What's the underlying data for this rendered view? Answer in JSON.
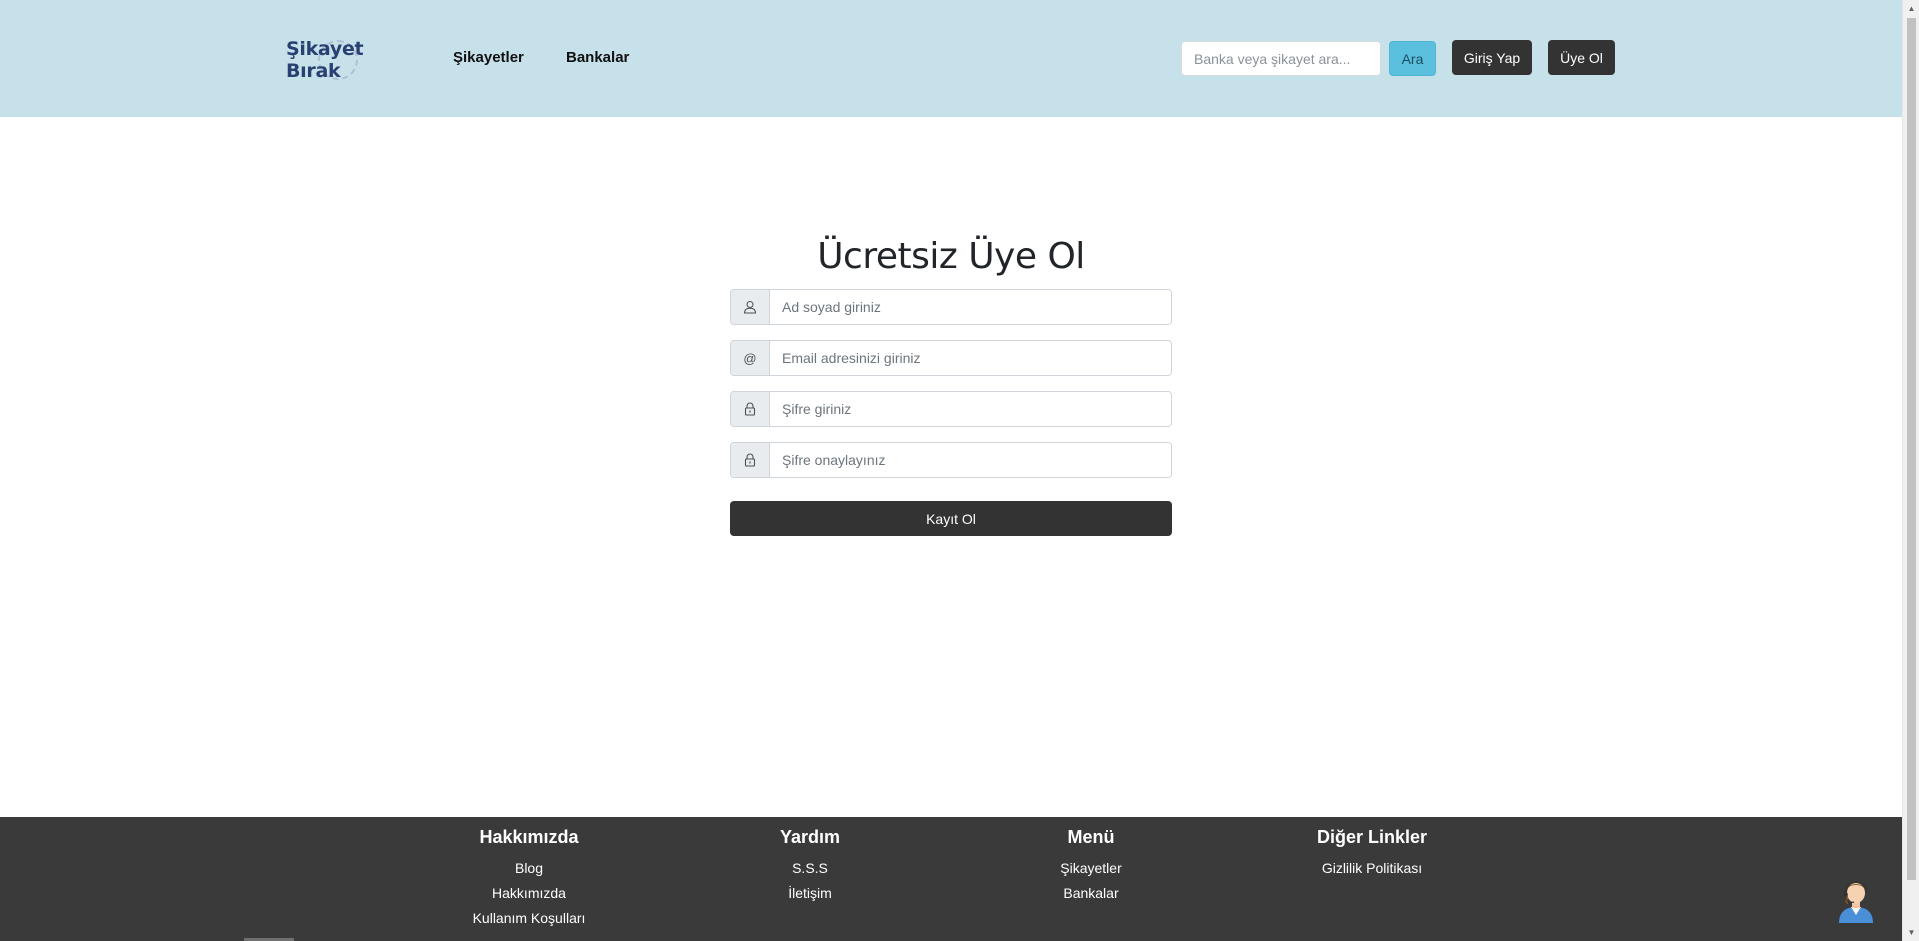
{
  "header": {
    "logo_text": "Şikayet Bırak",
    "nav": {
      "sikayetler": "Şikayetler",
      "bankalar": "Bankalar"
    },
    "search": {
      "placeholder": "Banka veya şikayet ara..."
    },
    "search_button": "Ara",
    "login_button": "Giriş Yap",
    "register_button": "Üye Ol"
  },
  "form": {
    "title": "Ücretsiz Üye Ol",
    "fields": [
      {
        "icon": "user-icon",
        "placeholder": "Ad soyad giriniz"
      },
      {
        "icon": "at-icon",
        "placeholder": "Email adresinizi giriniz"
      },
      {
        "icon": "lock-icon",
        "placeholder": "Şifre giriniz"
      },
      {
        "icon": "lock-icon",
        "placeholder": "Şifre onaylayınız"
      }
    ],
    "submit": "Kayıt Ol"
  },
  "footer": {
    "columns": [
      {
        "title": "Hakkımızda",
        "links": [
          "Blog",
          "Hakkımızda",
          "Kullanım Koşulları"
        ]
      },
      {
        "title": "Yardım",
        "links": [
          "S.S.S",
          "İletişim"
        ]
      },
      {
        "title": "Menü",
        "links": [
          "Şikayetler",
          "Bankalar"
        ]
      },
      {
        "title": "Diğer Linkler",
        "links": [
          "Gizlilik Politikası"
        ]
      }
    ]
  },
  "colors": {
    "header_bg": "#c7e1ea",
    "logo_text": "#2a3f72",
    "search_button_bg": "#5bc0de",
    "dark_button_bg": "#333333",
    "footer_bg": "#3a3a3a"
  },
  "icons": {
    "support": "support-agent-icon"
  }
}
